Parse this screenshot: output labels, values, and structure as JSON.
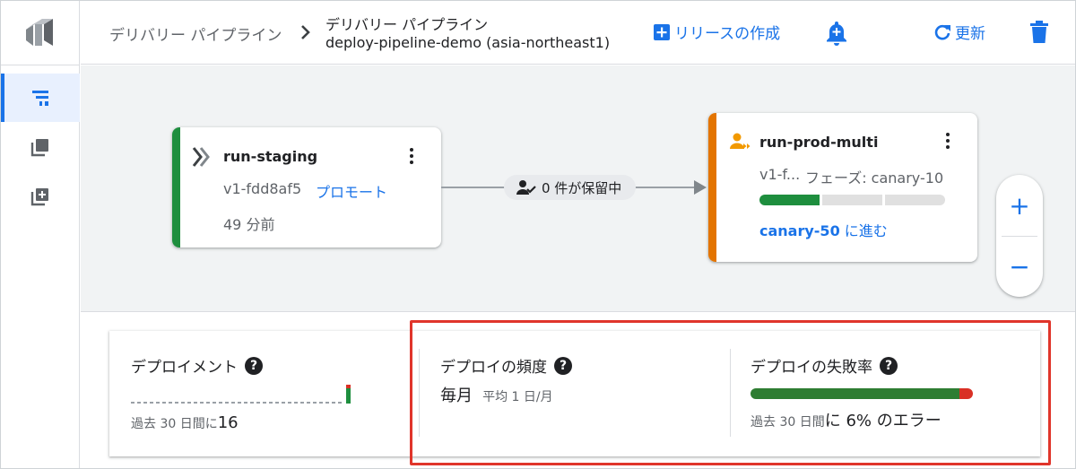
{
  "breadcrumb": {
    "root": "デリバリー パイプライン",
    "title": "デリバリー パイプライン",
    "subtitle": "deploy-pipeline-demo (asia-northeast1)"
  },
  "actions": {
    "create_release": "リリースの作成",
    "refresh": "更新"
  },
  "pipeline": {
    "stage1": {
      "name": "run-staging",
      "release": "v1-fdd8af5",
      "promote": "プロモート",
      "age": "49 分前",
      "color": "#1e8e3e"
    },
    "pending": "0 件が保留中",
    "stage2": {
      "name": "run-prod-multi",
      "release": "v1-f...",
      "phase": "フェーズ: canary-10",
      "advance_target": "canary-50",
      "advance_suffix": " に進む",
      "color": "#e37400",
      "phases_done": 1,
      "phases_total": 3
    }
  },
  "zoom": {
    "in": "+",
    "out": "−"
  },
  "metrics": {
    "deployments": {
      "title": "デプロイメント",
      "footer_small": "過去 30 日間に",
      "footer_count": "16"
    },
    "frequency": {
      "title": "デプロイの頻度",
      "value": "毎月",
      "sub": "平均 1 日/月"
    },
    "failure": {
      "title": "デプロイの失敗率",
      "footer_small": "過去 30 日間",
      "footer_main": "に 6% のエラー",
      "percent": 6
    }
  },
  "colors": {
    "accent": "#1a73e8",
    "success": "#1e8e3e",
    "error": "#d93025",
    "highlight": "#e0352b"
  }
}
